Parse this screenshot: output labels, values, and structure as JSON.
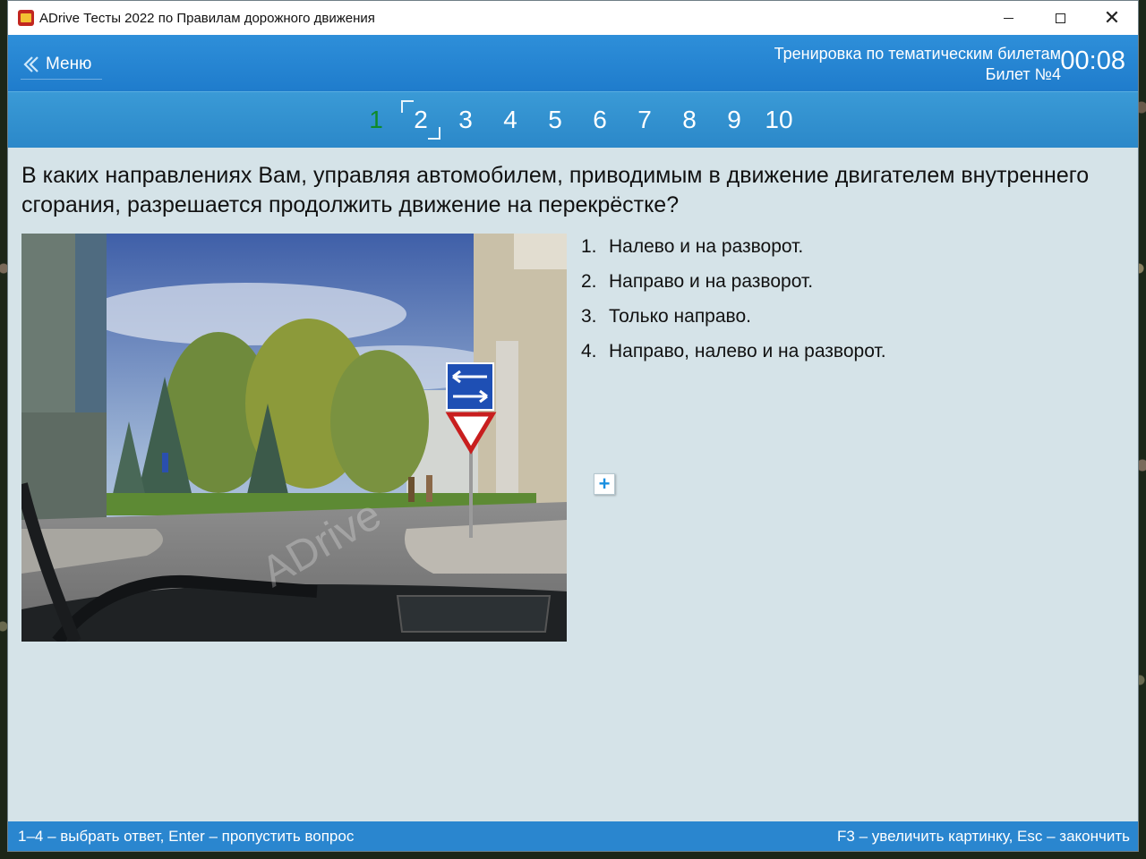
{
  "window": {
    "title": "ADrive Тесты 2022 по Правилам дорожного движения"
  },
  "header": {
    "menu_label": "Меню",
    "mode_line": "Тренировка по тематическим билетам",
    "ticket_line": "Билет №4",
    "timer": "00:08"
  },
  "question_numbers": [
    "1",
    "2",
    "3",
    "4",
    "5",
    "6",
    "7",
    "8",
    "9",
    "10"
  ],
  "question_status": {
    "answered": "1",
    "current": "2"
  },
  "question": {
    "text": "В каких направлениях Вам, управляя автомобилем, приводимым в движение двигателем внутреннего сгорания, разрешается продолжить движение на перекрёстке?",
    "image_watermark": "ADrive"
  },
  "answers": [
    {
      "num": "1.",
      "text": "Налево и на разворот."
    },
    {
      "num": "2.",
      "text": "Направо и на разворот."
    },
    {
      "num": "3.",
      "text": "Только направо."
    },
    {
      "num": "4.",
      "text": "Направо, налево и на разворот."
    }
  ],
  "zoom_button": {
    "icon": "plus-icon"
  },
  "footer": {
    "left_hint": "1–4 – выбрать ответ, Enter – пропустить вопрос",
    "right_hint": "F3 – увеличить картинку, Esc – закончить"
  },
  "colors": {
    "header_blue": "#2e8fd9",
    "answered_green": "#0f8a2a",
    "content_bg": "#d5e3e8",
    "footer_blue": "#2a86cf"
  }
}
